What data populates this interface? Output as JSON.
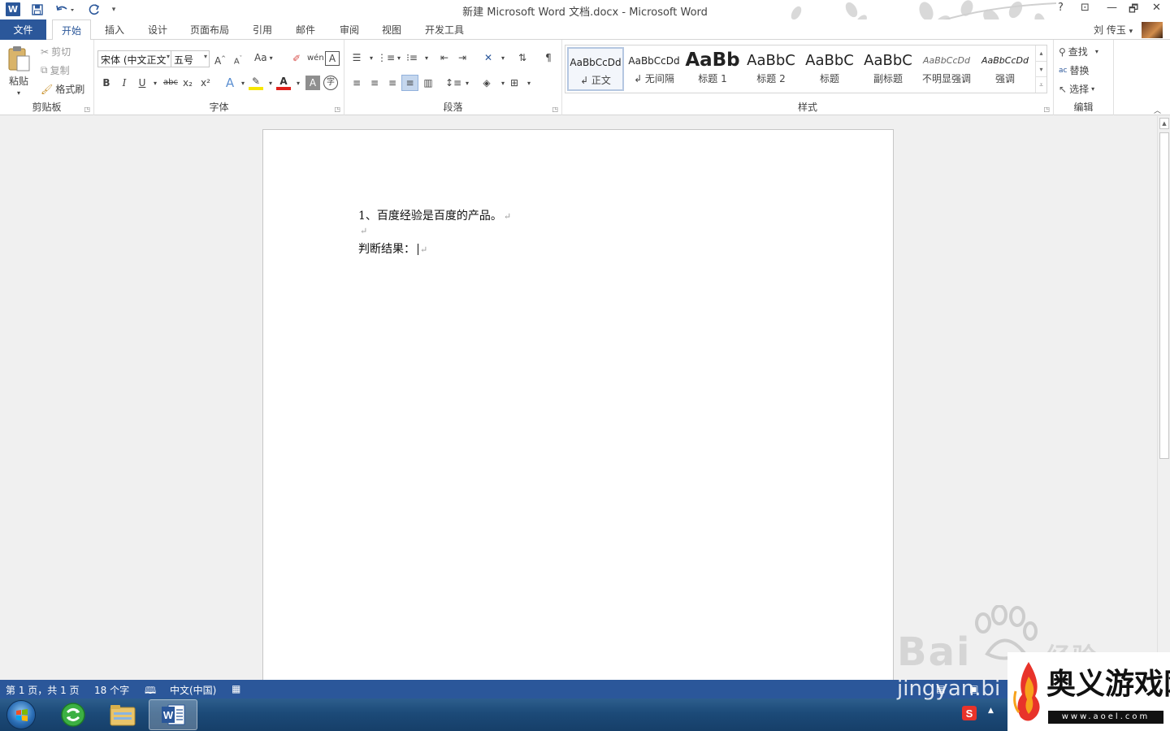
{
  "window": {
    "title": "新建 Microsoft Word 文档.docx - Microsoft Word",
    "help": "?",
    "controls": [
      "⊡",
      "🗗",
      "✕"
    ]
  },
  "quick_access": {
    "icons": [
      "word-logo",
      "save-icon",
      "undo-icon",
      "redo-icon",
      "customize-icon"
    ],
    "logo_letter": "W"
  },
  "tabs": {
    "file": "文件",
    "items": [
      "开始",
      "插入",
      "设计",
      "页面布局",
      "引用",
      "邮件",
      "审阅",
      "视图",
      "开发工具"
    ],
    "active": "开始"
  },
  "user": {
    "name": "刘 传玉",
    "dropdown": "▾"
  },
  "ribbon": {
    "clipboard": {
      "label": "剪贴板",
      "paste": "粘贴",
      "cut": "剪切",
      "copy": "复制",
      "format_painter": "格式刷"
    },
    "font": {
      "label": "字体",
      "font_name": "宋体 (中文正文",
      "font_size": "五号",
      "change_case": "Aa",
      "bold": "B",
      "italic": "I",
      "underline": "U",
      "strikethrough": "abc",
      "subscript": "x₂",
      "superscript": "x²"
    },
    "paragraph": {
      "label": "段落"
    },
    "styles": {
      "label": "样式",
      "items": [
        {
          "sample": "AaBbCcDd",
          "name": "↲ 正文"
        },
        {
          "sample": "AaBbCcDd",
          "name": "↲ 无间隔"
        },
        {
          "sample": "AaBb",
          "name": "标题 1"
        },
        {
          "sample": "AaBbC",
          "name": "标题 2"
        },
        {
          "sample": "AaBbC",
          "name": "标题"
        },
        {
          "sample": "AaBbC",
          "name": "副标题"
        },
        {
          "sample": "AaBbCcDd",
          "name": "不明显强调"
        },
        {
          "sample": "AaBbCcDd",
          "name": "强调"
        }
      ],
      "selected_index": 0
    },
    "editing": {
      "label": "编辑",
      "find": "查找",
      "replace": "替换",
      "select": "选择"
    }
  },
  "document": {
    "lines": [
      {
        "text": "1、百度经验是百度的产品。",
        "mark": "↵"
      },
      {
        "text": "",
        "mark": "↵"
      },
      {
        "text": "判断结果：",
        "mark": "↵"
      }
    ]
  },
  "statusbar": {
    "page": "第 1 页，共 1 页",
    "words": "18 个字",
    "language": "中文(中国)"
  },
  "watermarks": {
    "baidu": "Bai",
    "baidu_tail": "经验",
    "jingyan": "jingyan.bi",
    "site_title": "奥义游戏网",
    "site_url": "www.aoel.com"
  }
}
